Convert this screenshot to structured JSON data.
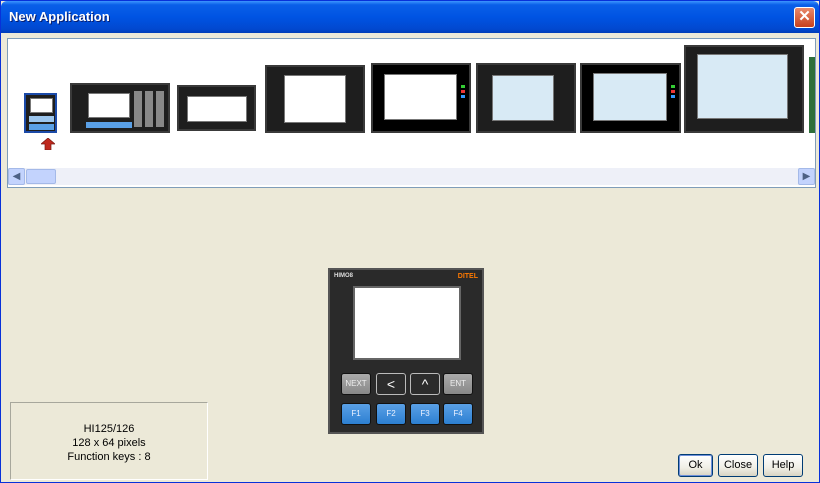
{
  "window": {
    "title": "New Application",
    "close_glyph": "✕"
  },
  "gallery": {
    "items": [
      {
        "name": "HI125/126",
        "selected": true
      },
      {
        "name": "keypad-model"
      },
      {
        "name": "wide-model"
      },
      {
        "name": "panel-model-1"
      },
      {
        "name": "panel-model-2"
      },
      {
        "name": "panel-model-3"
      },
      {
        "name": "panel-model-4"
      },
      {
        "name": "panel-model-5"
      }
    ],
    "scroll_left": "◀",
    "scroll_right": "▶"
  },
  "preview": {
    "model_label": "HIMO8",
    "brand": "DITEL",
    "keys_row1": [
      "NEXT",
      "<",
      "^",
      "ENT"
    ],
    "keys_row2": [
      "F1",
      "F2",
      "F3",
      "F4"
    ]
  },
  "info": {
    "model": "HI125/126",
    "resolution": "128 x 64 pixels",
    "function_keys": "Function keys : 8"
  },
  "buttons": {
    "ok": "Ok",
    "close": "Close",
    "help": "Help"
  }
}
